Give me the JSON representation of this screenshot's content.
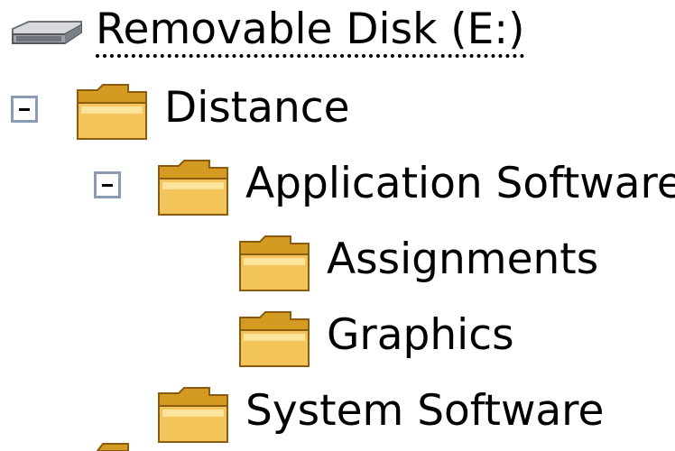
{
  "tree": {
    "root": {
      "label": "Removable Disk (E:)",
      "icon": "drive-icon"
    },
    "items": [
      {
        "label": "Distance",
        "icon": "folder-icon",
        "expanded": true
      },
      {
        "label": "Application Software",
        "icon": "folder-icon",
        "expanded": true
      },
      {
        "label": "Assignments",
        "icon": "folder-icon"
      },
      {
        "label": "Graphics",
        "icon": "folder-icon"
      },
      {
        "label": "System Software",
        "icon": "folder-icon"
      }
    ]
  },
  "colors": {
    "folder_fill": "#f2c45a",
    "folder_shade": "#d49a22",
    "folder_light": "#fde39a",
    "toggle_border": "#8a9bb3"
  }
}
